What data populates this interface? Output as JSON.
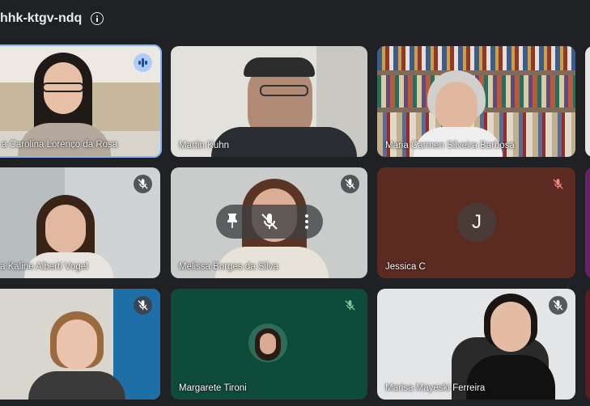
{
  "meeting": {
    "code": "hhk-ktgv-ndq",
    "info_icon": "info-icon"
  },
  "participants": [
    {
      "name": "a Carolina Lorenço da Rosa",
      "mic": "speaking"
    },
    {
      "name": "Martin Kuhn",
      "mic": "on"
    },
    {
      "name": "Maria Carmen Silveira Barbosa",
      "mic": "on"
    },
    {
      "name": "a Kaline Alberti Vogel",
      "mic": "muted"
    },
    {
      "name": "Melissa Borges da Silva",
      "mic": "muted"
    },
    {
      "name": "Jessica C",
      "mic": "muted",
      "avatar_letter": "J"
    },
    {
      "name": "",
      "mic": "muted"
    },
    {
      "name": "Margarete Tironi",
      "mic": "muted"
    },
    {
      "name": "Marisa Mayeski Ferreira",
      "mic": "muted"
    }
  ],
  "colors": {
    "background": "#202124",
    "active_speaker_border": "#8ab4f8",
    "muted_red": "#f28b82",
    "muted_green": "#81c995"
  }
}
